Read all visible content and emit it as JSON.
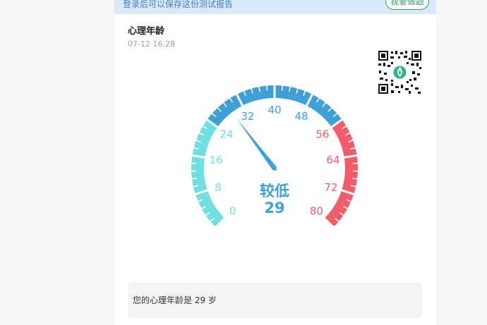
{
  "banner": {
    "text": "登录后可以保存这份测试报告",
    "button_label": "我要做题"
  },
  "report": {
    "title": "心理年龄",
    "time": "07-12 16:28"
  },
  "gauge": {
    "min": 0,
    "max": 80,
    "value": 29,
    "level_text": "较低",
    "value_text": "29",
    "tick_labels": [
      "0",
      "8",
      "16",
      "24",
      "32",
      "40",
      "48",
      "56",
      "64",
      "72",
      "80"
    ],
    "colors": {
      "low": "#6fdfe0",
      "mid": "#3fa0d8",
      "high": "#f25c6b"
    }
  },
  "answer": {
    "text": "您的心理年龄是 29 岁"
  }
}
